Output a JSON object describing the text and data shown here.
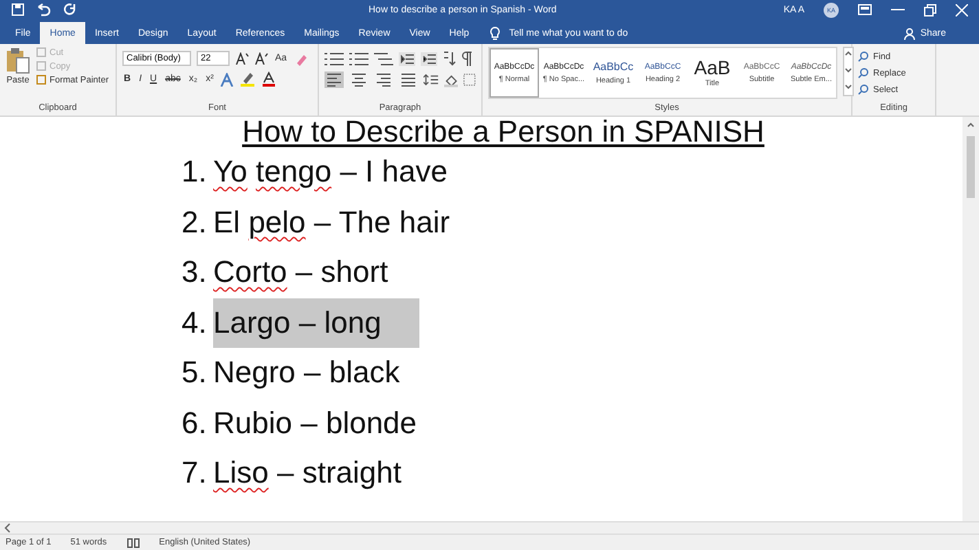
{
  "window": {
    "title": "How to describe a person in Spanish  -  Word",
    "user": "KA A",
    "avatar": "KA"
  },
  "tabs": [
    {
      "label": "File",
      "selected": false
    },
    {
      "label": "Home",
      "selected": true
    },
    {
      "label": "Insert",
      "selected": false
    },
    {
      "label": "Design",
      "selected": false
    },
    {
      "label": "Layout",
      "selected": false
    },
    {
      "label": "References",
      "selected": false
    },
    {
      "label": "Mailings",
      "selected": false
    },
    {
      "label": "Review",
      "selected": false
    },
    {
      "label": "View",
      "selected": false
    },
    {
      "label": "Help",
      "selected": false
    }
  ],
  "tell_me": {
    "placeholder": "Tell me what you want to do"
  },
  "share": "Share",
  "clipboard": {
    "label": "Clipboard",
    "paste": "Paste",
    "items": [
      {
        "label": "Cut",
        "disabled": true
      },
      {
        "label": "Copy",
        "disabled": true
      },
      {
        "label": "Format Painter",
        "disabled": false
      }
    ]
  },
  "font": {
    "label": "Font",
    "name": "Calibri (Body)",
    "size": "22",
    "case_button": "Aa",
    "format_buttons": [
      "B",
      "I",
      "U",
      "abc",
      "x₂",
      "x²"
    ]
  },
  "paragraph": {
    "label": "Paragraph",
    "alignments": [
      {
        "selected": true
      },
      {
        "selected": false
      },
      {
        "selected": false
      },
      {
        "selected": false
      }
    ]
  },
  "styles": {
    "label": "Styles",
    "items": [
      {
        "preview": "AaBbCcDc",
        "name": "¶ Normal",
        "selected": true,
        "kind": "normal"
      },
      {
        "preview": "AaBbCcDc",
        "name": "¶ No Spac...",
        "selected": false,
        "kind": "normal"
      },
      {
        "preview": "AaBbCc",
        "name": "Heading 1",
        "selected": false,
        "kind": "heading1"
      },
      {
        "preview": "AaBbCcC",
        "name": "Heading 2",
        "selected": false,
        "kind": "heading2"
      },
      {
        "preview": "AaB",
        "name": "Title",
        "selected": false,
        "kind": "title"
      },
      {
        "preview": "AaBbCcC",
        "name": "Subtitle",
        "selected": false,
        "kind": "subtitle"
      },
      {
        "preview": "AaBbCcDc",
        "name": "Subtle Em...",
        "selected": false,
        "kind": "emphasis"
      }
    ]
  },
  "editing": {
    "label": "Editing",
    "items": [
      "Find",
      "Replace",
      "Select"
    ]
  },
  "document": {
    "title": "How to Describe a Person in SPANISH",
    "items": [
      {
        "number": "1.",
        "words": [
          {
            "text": "Yo",
            "flagged": true
          },
          {
            "text": "tengo",
            "flagged": true
          }
        ],
        "rest": "– I have",
        "highlighted": false
      },
      {
        "number": "2.",
        "words": [
          {
            "text": "El",
            "flagged": false
          },
          {
            "text": "pelo",
            "flagged": true
          }
        ],
        "rest": "– The hair",
        "highlighted": false
      },
      {
        "number": "3.",
        "words": [
          {
            "text": "Corto",
            "flagged": true
          }
        ],
        "rest": "– short",
        "highlighted": false
      },
      {
        "number": "4.",
        "words": [
          {
            "text": "Largo",
            "flagged": false
          }
        ],
        "rest": "– long",
        "highlighted": true
      },
      {
        "number": "5.",
        "words": [
          {
            "text": "Negro",
            "flagged": false
          }
        ],
        "rest": "– black",
        "highlighted": false
      },
      {
        "number": "6.",
        "words": [
          {
            "text": "Rubio",
            "flagged": false
          }
        ],
        "rest": "– blonde",
        "highlighted": false
      },
      {
        "number": "7.",
        "words": [
          {
            "text": "Liso",
            "flagged": true
          }
        ],
        "rest": "– straight",
        "highlighted": false
      }
    ]
  },
  "status_bar": {
    "page": "Page 1 of 1",
    "words": "51 words",
    "language": "English (United States)"
  }
}
